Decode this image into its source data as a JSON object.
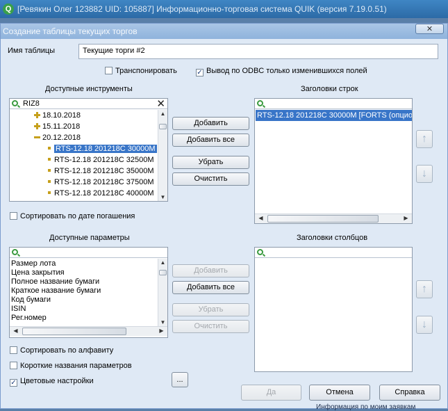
{
  "app": {
    "title": "[Ревякин Олег 123882 UID: 105887] Информационно-торговая система QUIK (версия 7.19.0.51)"
  },
  "dialog": {
    "title": "Создание таблицы текущих торгов",
    "close_glyph": "✕",
    "table_name_label": "Имя таблицы",
    "table_name_value": "Текущие торги #2",
    "transpose_label": "Транспонировать",
    "transpose_checked": false,
    "odbc_label": "Вывод по ODBC только изменившихся  полей",
    "odbc_checked": true
  },
  "instruments": {
    "header": "Доступные инструменты",
    "search_value": "RIZ8",
    "clear_glyph": "✕",
    "tree": [
      {
        "type": "collapsed",
        "label": "18.10.2018"
      },
      {
        "type": "collapsed",
        "label": "15.11.2018"
      },
      {
        "type": "expanded",
        "label": "20.12.2018"
      },
      {
        "type": "leaf",
        "label": "RTS-12.18  201218C  30000M",
        "selected": true
      },
      {
        "type": "leaf",
        "label": "RTS-12.18  201218C  32500M"
      },
      {
        "type": "leaf",
        "label": "RTS-12.18  201218C  35000M"
      },
      {
        "type": "leaf",
        "label": "RTS-12.18  201218C  37500M"
      },
      {
        "type": "leaf",
        "label": "RTS-12.18  201218C  40000M"
      }
    ],
    "sort_by_expiry_label": "Сортировать по дате погашения",
    "sort_by_expiry_checked": false
  },
  "buttons_top": {
    "add": "Добавить",
    "add_all": "Добавить все",
    "remove": "Убрать",
    "clear": "Очистить"
  },
  "row_headers": {
    "header": "Заголовки строк",
    "items": [
      "RTS-12.18  201218C  30000M [FORTS (опцио"
    ]
  },
  "parameters": {
    "header": "Доступные параметры",
    "items": [
      "Размер лота",
      "Цена закрытия",
      "Полное название бумаги",
      "Краткое название бумаги",
      "Код бумаги",
      "ISIN",
      "Рег.номер"
    ],
    "sort_alpha_label": "Сортировать по алфавиту",
    "sort_alpha_checked": false,
    "short_names_label": "Короткие названия параметров",
    "short_names_checked": false,
    "color_settings_label": "Цветовые настройки",
    "color_settings_checked": true,
    "more_label": "..."
  },
  "buttons_bottom": {
    "add": "Добавить",
    "add_all": "Добавить все",
    "remove": "Убрать",
    "clear": "Очистить"
  },
  "column_headers": {
    "header": "Заголовки столбцов"
  },
  "footer": {
    "ok": "Да",
    "cancel": "Отмена",
    "help": "Справка"
  },
  "icons": {
    "up": "up-arrow-icon",
    "down": "down-arrow-icon",
    "search": "search-icon"
  },
  "background_text": "Информация по моим заявкам"
}
